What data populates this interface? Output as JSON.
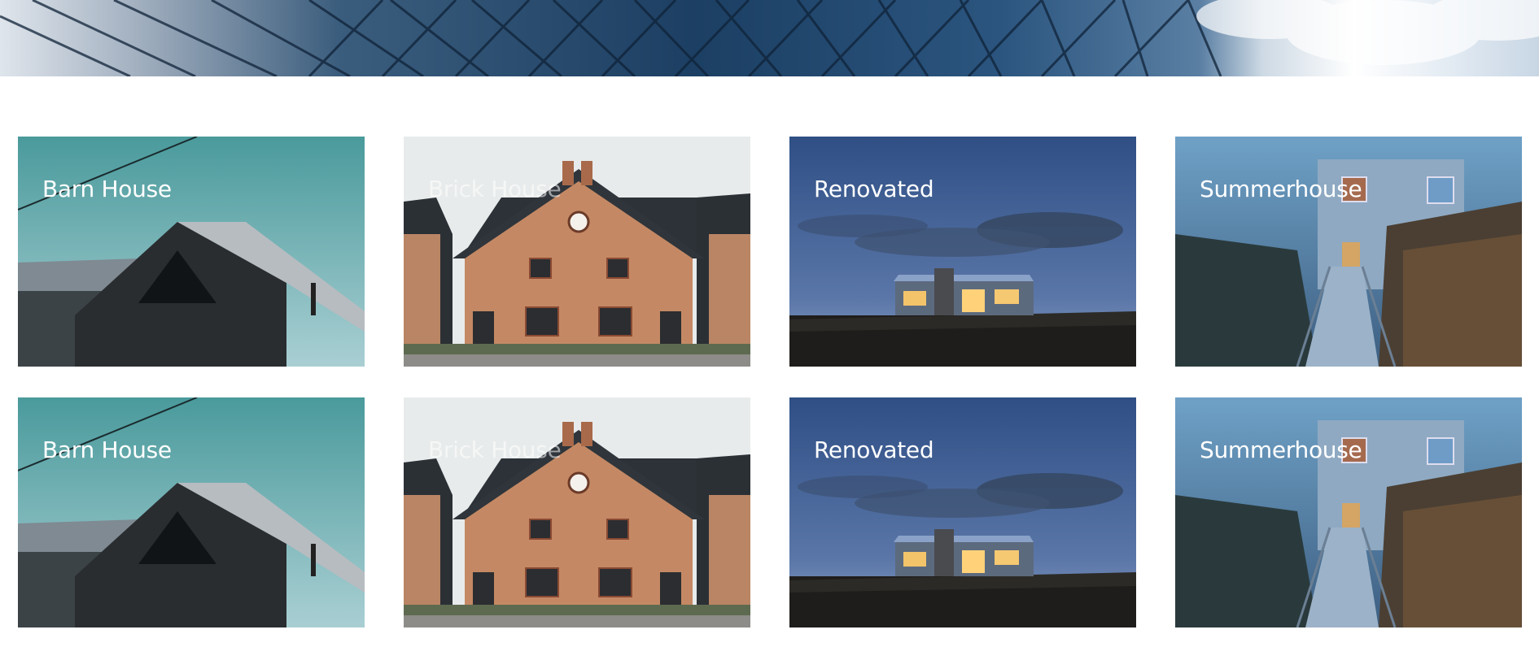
{
  "banner": {
    "image": "glass-building-facade"
  },
  "cards": [
    {
      "title": "Barn House",
      "image": "barn-house-photo"
    },
    {
      "title": "Brick House",
      "image": "brick-house-photo"
    },
    {
      "title": "Renovated",
      "image": "renovated-house-photo"
    },
    {
      "title": "Summerhouse",
      "image": "summerhouse-photo"
    },
    {
      "title": "Barn House",
      "image": "barn-house-photo"
    },
    {
      "title": "Brick House",
      "image": "brick-house-photo"
    },
    {
      "title": "Renovated",
      "image": "renovated-house-photo"
    },
    {
      "title": "Summerhouse",
      "image": "summerhouse-photo"
    }
  ]
}
